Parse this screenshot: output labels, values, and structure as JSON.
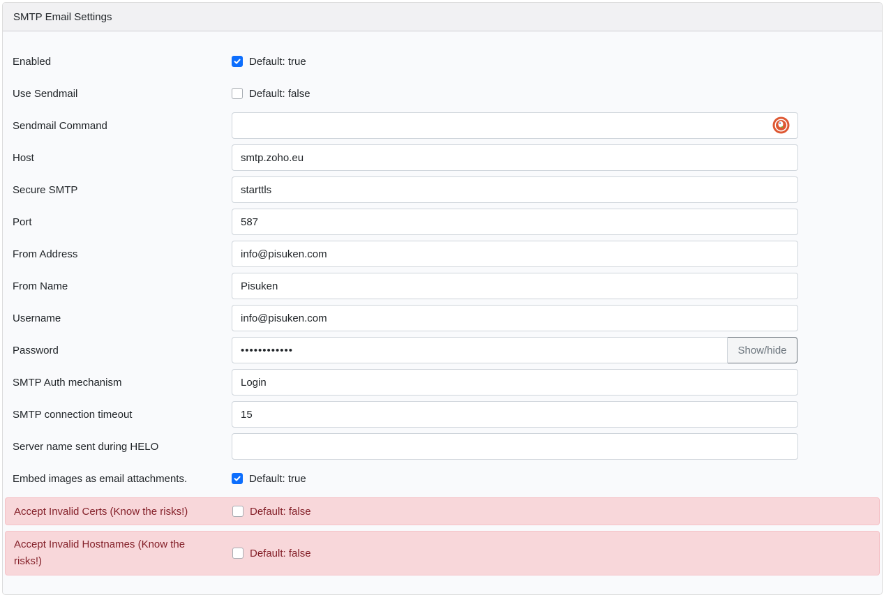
{
  "header": {
    "title": "SMTP Email Settings"
  },
  "fields": {
    "enabled": {
      "label": "Enabled",
      "checked": true,
      "default": "Default: true"
    },
    "use_sendmail": {
      "label": "Use Sendmail",
      "checked": false,
      "default": "Default: false"
    },
    "sendmail_command": {
      "label": "Sendmail Command",
      "value": "",
      "icon": "duckduckgo-icon"
    },
    "host": {
      "label": "Host",
      "value": "smtp.zoho.eu"
    },
    "secure_smtp": {
      "label": "Secure SMTP",
      "value": "starttls"
    },
    "port": {
      "label": "Port",
      "value": "587"
    },
    "from_address": {
      "label": "From Address",
      "value": "info@pisuken.com"
    },
    "from_name": {
      "label": "From Name",
      "value": "Pisuken"
    },
    "username": {
      "label": "Username",
      "value": "info@pisuken.com"
    },
    "password": {
      "label": "Password",
      "value": "••••••••••••",
      "button": "Show/hide"
    },
    "auth_mechanism": {
      "label": "SMTP Auth mechanism",
      "value": "Login"
    },
    "timeout": {
      "label": "SMTP connection timeout",
      "value": "15"
    },
    "helo": {
      "label": "Server name sent during HELO",
      "value": ""
    },
    "embed_images": {
      "label": "Embed images as email attachments.",
      "checked": true,
      "default": "Default: true"
    },
    "invalid_certs": {
      "label": "Accept Invalid Certs (Know the risks!)",
      "checked": false,
      "default": "Default: false"
    },
    "invalid_hostnames": {
      "label": "Accept Invalid Hostnames (Know the risks!)",
      "checked": false,
      "default": "Default: false"
    }
  },
  "colors": {
    "accent": "#0d6efd",
    "danger_bg": "#f8d7da",
    "danger_text": "#842029"
  }
}
